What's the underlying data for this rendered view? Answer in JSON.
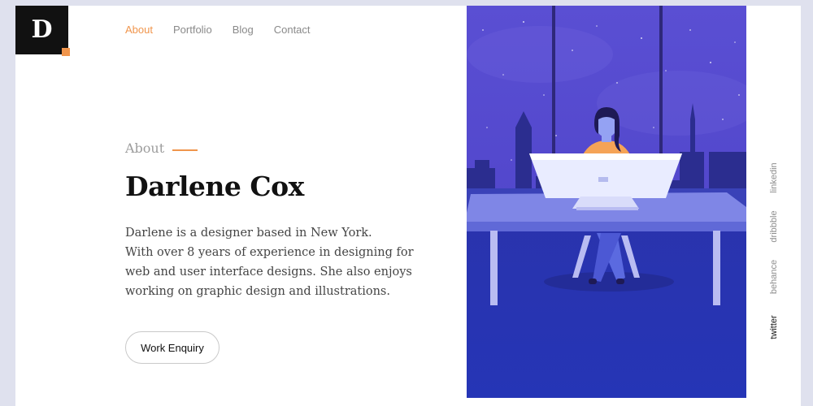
{
  "brand": {
    "logo_letter": "D"
  },
  "nav": {
    "items": [
      {
        "label": "About",
        "active": true
      },
      {
        "label": "Portfolio",
        "active": false
      },
      {
        "label": "Blog",
        "active": false
      },
      {
        "label": "Contact",
        "active": false
      }
    ]
  },
  "hero": {
    "eyebrow": "About",
    "name": "Darlene Cox",
    "bio_lines": [
      "Darlene is a designer based in New York.",
      "With over 8 years of experience in designing for",
      "web and user interface designs. She also enjoys",
      "working on graphic design and illustrations."
    ],
    "cta_label": "Work Enquiry"
  },
  "social": {
    "items": [
      {
        "label": "linkedin",
        "active": false
      },
      {
        "label": "dribbble",
        "active": false
      },
      {
        "label": "behance",
        "active": false
      },
      {
        "label": "twitter",
        "active": true
      }
    ]
  },
  "colors": {
    "accent": "#f0954c",
    "page_background": "#dfe1ee",
    "illustration_sky": "#5a4fd3",
    "illustration_floor": "#2f3ab7"
  }
}
